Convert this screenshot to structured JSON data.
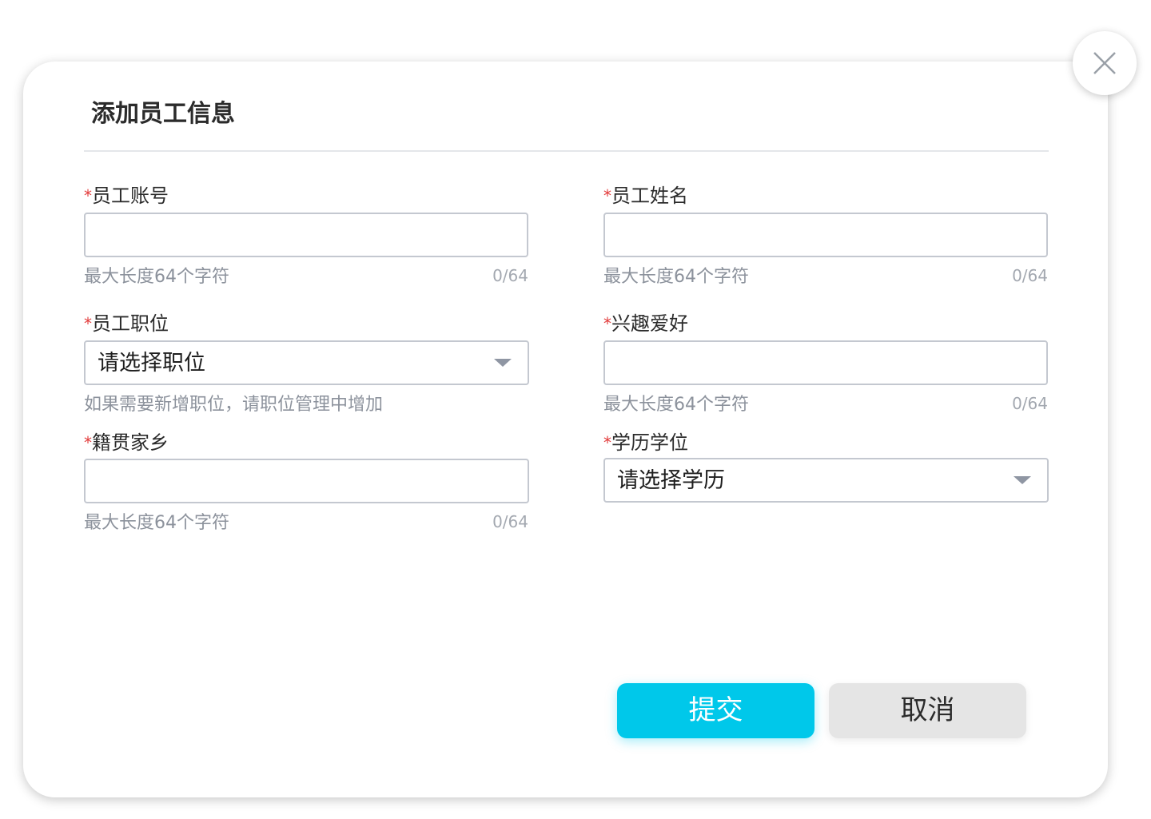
{
  "dialog": {
    "title": "添加员工信息",
    "required_mark": "*"
  },
  "fields": {
    "account": {
      "label": "员工账号",
      "value": "",
      "hint": "最大长度64个字符",
      "counter": "0/64"
    },
    "name": {
      "label": "员工姓名",
      "value": "",
      "hint": "最大长度64个字符",
      "counter": "0/64"
    },
    "position": {
      "label": "员工职位",
      "selected": "请选择职位",
      "hint": "如果需要新增职位，请职位管理中增加"
    },
    "hobby": {
      "label": "兴趣爱好",
      "value": "",
      "hint": "最大长度64个字符",
      "counter": "0/64"
    },
    "hometown": {
      "label": "籍贯家乡",
      "value": "",
      "hint": "最大长度64个字符",
      "counter": "0/64"
    },
    "education": {
      "label": "学历学位",
      "selected": "请选择学历"
    }
  },
  "actions": {
    "submit_label": "提交",
    "cancel_label": "取消"
  },
  "colors": {
    "primary": "#00c8ea",
    "required": "#e23a3a",
    "cancel_bg": "#e5e5e5"
  },
  "icons": {
    "close": "close-icon",
    "dropdown": "chevron-down-icon"
  }
}
